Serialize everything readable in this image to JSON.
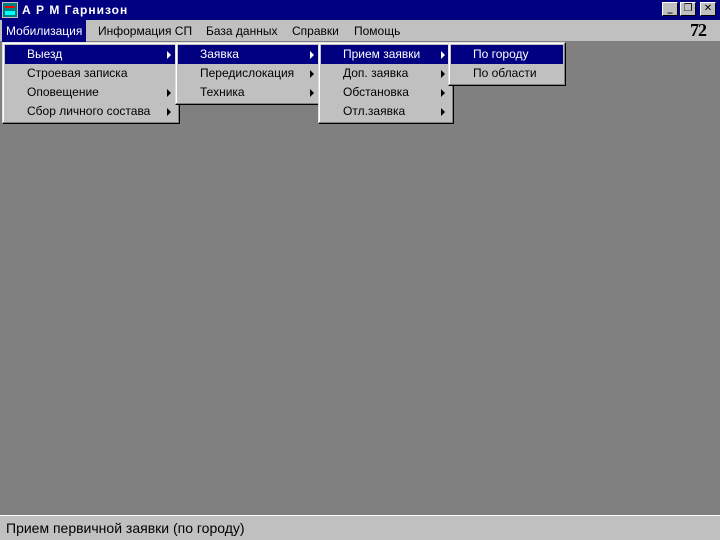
{
  "window": {
    "title": "А Р М   Гарнизон",
    "minimize_glyph": "_",
    "restore_glyph": "❐",
    "close_glyph": "✕",
    "counter": "72"
  },
  "menubar": {
    "items": [
      {
        "label": "Мобилизация"
      },
      {
        "label": "Информация СП"
      },
      {
        "label": "База данных"
      },
      {
        "label": "Справки"
      },
      {
        "label": "Помощь"
      }
    ]
  },
  "menu_level1": [
    {
      "label": "Выезд"
    },
    {
      "label": "Строевая записка"
    },
    {
      "label": "Оповещение"
    },
    {
      "label": "Сбор личного состава"
    }
  ],
  "menu_level2": [
    {
      "label": "Заявка"
    },
    {
      "label": "Передислокация"
    },
    {
      "label": "Техника"
    }
  ],
  "menu_level3": [
    {
      "label": "Прием заявки"
    },
    {
      "label": "Доп. заявка"
    },
    {
      "label": "Обстановка"
    },
    {
      "label": "Отл.заявка"
    }
  ],
  "menu_level4": [
    {
      "label": "По городу"
    },
    {
      "label": "По области"
    }
  ],
  "status": {
    "text": "Прием первичной заявки (по городу)"
  },
  "colors": {
    "titlebar": "#000080",
    "desktop": "#808080",
    "face": "#c0c0c0",
    "highlight": "#000080"
  }
}
